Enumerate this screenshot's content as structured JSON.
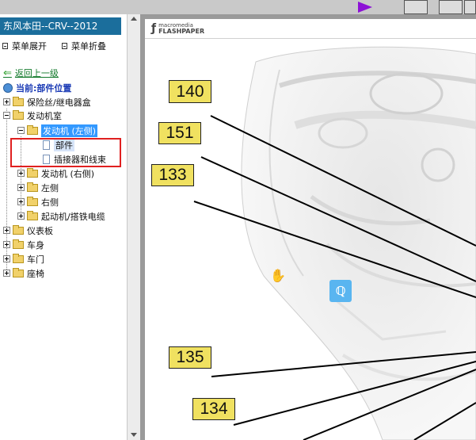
{
  "sidebar": {
    "title": "东风本田--CRV--2012",
    "expand_label": "菜单展开",
    "collapse_label": "菜单折叠",
    "back_label": "返回上一级",
    "current_label": "当前:部件位置",
    "tree": [
      {
        "label": "保险丝/继电器盒",
        "level": 0,
        "toggle": "plus",
        "icon": "folder"
      },
      {
        "label": "发动机室",
        "level": 0,
        "toggle": "minus",
        "icon": "folder"
      },
      {
        "label": "发动机 (左侧)",
        "level": 1,
        "toggle": "minus",
        "icon": "folder-open",
        "state": "selected"
      },
      {
        "label": "部件",
        "level": 2,
        "toggle": "none",
        "icon": "document",
        "state": "current"
      },
      {
        "label": "插接器和线束",
        "level": 2,
        "toggle": "none",
        "icon": "document"
      },
      {
        "label": "发动机 (右侧)",
        "level": 1,
        "toggle": "plus",
        "icon": "folder"
      },
      {
        "label": "左侧",
        "level": 1,
        "toggle": "plus",
        "icon": "folder"
      },
      {
        "label": "右侧",
        "level": 1,
        "toggle": "plus",
        "icon": "folder"
      },
      {
        "label": "起动机/搭铁电缆",
        "level": 1,
        "toggle": "plus",
        "icon": "folder"
      },
      {
        "label": "仪表板",
        "level": 0,
        "toggle": "plus",
        "icon": "folder"
      },
      {
        "label": "车身",
        "level": 0,
        "toggle": "plus",
        "icon": "folder"
      },
      {
        "label": "车门",
        "level": 0,
        "toggle": "plus",
        "icon": "folder"
      },
      {
        "label": "座椅",
        "level": 0,
        "toggle": "plus",
        "icon": "folder"
      }
    ]
  },
  "viewer": {
    "logo_macromedia": "macromedia",
    "logo_flashpaper": "FLASHPAPER",
    "callouts": [
      "140",
      "151",
      "133",
      "135",
      "134"
    ],
    "colors": {
      "callout_fill": "#f0e160",
      "selection": "#3399ff",
      "title_bar": "#1b6e9c",
      "highlight": "#e02020"
    }
  },
  "toolbar": {
    "buttons": [
      "play-icon",
      "fit-page-icon",
      "fit-width-icon",
      "page-icon"
    ]
  }
}
